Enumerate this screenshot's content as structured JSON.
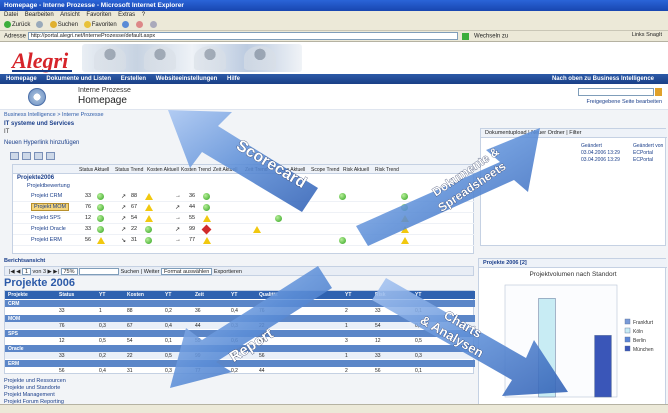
{
  "browser": {
    "title": "Homepage - Interne Prozesse - Microsoft Internet Explorer",
    "menu": [
      "Datei",
      "Bearbeiten",
      "Ansicht",
      "Favoriten",
      "Extras",
      "?"
    ],
    "toolbar": {
      "back": "Zurück",
      "search": "Suchen",
      "favorites": "Favoriten"
    },
    "address_label": "Adresse",
    "address_value": "http://portal.alegri.net/InterneProzesse/default.aspx",
    "go_label": "Wechseln zu",
    "links_label": "Links",
    "snagit_label": "SnagIt"
  },
  "banner": {
    "logo": "Alegri"
  },
  "nav": {
    "items": [
      "Homepage",
      "Dokumente und Listen",
      "Erstellen",
      "Websiteeinstellungen",
      "Hilfe"
    ],
    "right": "Nach oben zu Business Intelligence"
  },
  "site": {
    "subtitle": "Interne Prozesse",
    "title": "Homepage",
    "edit_link": "Freigegebene Seite bearbeiten"
  },
  "breadcrumb": "Business Intelligence > Interne Prozesse",
  "links_webpart": {
    "title": "IT systeme und Services",
    "item": "IT",
    "new_link": "Neuen Hyperlink hinzufügen"
  },
  "scorecard": {
    "columns": [
      "Status Aktuell",
      "Status Trend",
      "Kosten Aktuell",
      "Kosten Trend",
      "Zeit Aktuell",
      "Zeit Trend",
      "Scope Aktuell",
      "Scope Trend",
      "Risk Aktuell",
      "Risk Trend"
    ],
    "group": "Projekte2006",
    "subgroup": "Projektbewertung",
    "rows": [
      {
        "name": "Projekt CRM",
        "v1": "33",
        "v2": "88",
        "v3": "36"
      },
      {
        "name": "Projekt MOM",
        "v1": "76",
        "v2": "67",
        "v3": "44"
      },
      {
        "name": "Projekt SPS",
        "v1": "12",
        "v2": "54",
        "v3": "55"
      },
      {
        "name": "Projekt Oracle",
        "v1": "33",
        "v2": "22",
        "v3": "99"
      },
      {
        "name": "Projekt ERM",
        "v1": "56",
        "v2": "31",
        "v3": "77"
      }
    ]
  },
  "right_panel": {
    "tools": [
      "Dokumentupload",
      "Neuer Ordner",
      "Filter"
    ],
    "col_changed": "Geändert",
    "col_by": "Geändert von",
    "rows": [
      {
        "date": "03.04.2006 13:29",
        "by": "ECPortal"
      },
      {
        "date": "03.04.2006 13:29",
        "by": "ECPortal"
      }
    ]
  },
  "report": {
    "title": "Berichtsansicht",
    "page": "von 3",
    "zoom": "75%",
    "find": "Suchen | Weiter",
    "format": "Format auswählen",
    "export": "Exportieren",
    "heading": "Projekte 2006",
    "columns": [
      "Projekte",
      "Status",
      "YT",
      "Kosten",
      "YT",
      "Zeit",
      "YT",
      "Qualität",
      "YT",
      "Risk",
      "YT"
    ],
    "groups": [
      "CRM",
      "MOM",
      "SPS",
      "Oracle",
      "ERM"
    ],
    "rows": [
      [
        "33",
        "1",
        "88",
        "0,2",
        "36",
        "0,4",
        "76",
        "2",
        "33",
        "0,1"
      ],
      [
        "76",
        "0,3",
        "67",
        "0,4",
        "44",
        "0,3",
        "22",
        "1",
        "54",
        "0,2"
      ],
      [
        "12",
        "0,5",
        "54",
        "0,1",
        "55",
        "0,6",
        "43",
        "3",
        "12",
        "0,5"
      ],
      [
        "33",
        "0,2",
        "22",
        "0,5",
        "99",
        "0,1",
        "56",
        "1",
        "33",
        "0,3"
      ],
      [
        "56",
        "0,4",
        "31",
        "0,3",
        "77",
        "0,2",
        "44",
        "2",
        "56",
        "0,1"
      ]
    ]
  },
  "bottom_links": [
    "Projekte und Ressourcen",
    "Projekte und Standorte",
    "Projekt Management",
    "Projekt Forum Reporting"
  ],
  "chart_panel": {
    "header": "Projekte 2006 [2]"
  },
  "chart_data": {
    "type": "bar",
    "title": "Projektvolumen nach Standort",
    "categories": [
      "Frankfurt",
      "Köln",
      "Berlin",
      "München"
    ],
    "series": [
      {
        "name": "Frankfurt",
        "values": [
          0
        ]
      },
      {
        "name": "Köln",
        "values": [
          88
        ]
      },
      {
        "name": "Berlin",
        "values": [
          0
        ]
      },
      {
        "name": "München",
        "values": [
          55
        ]
      }
    ],
    "colors": [
      "#7a9bd8",
      "#c8ecf4",
      "#5c86d6",
      "#3a56b8"
    ],
    "ylim": [
      0,
      100
    ],
    "legend": "right"
  },
  "overlay_arrows": [
    {
      "label": "Scorecard",
      "color": "#5d8fd8"
    },
    {
      "label": "Dokumente & Spreadsheets",
      "color": "#5d8fd8"
    },
    {
      "label": "Report",
      "color": "#5d8fd8"
    },
    {
      "label": "Charts & Analysen",
      "color": "#5d8fd8"
    }
  ]
}
